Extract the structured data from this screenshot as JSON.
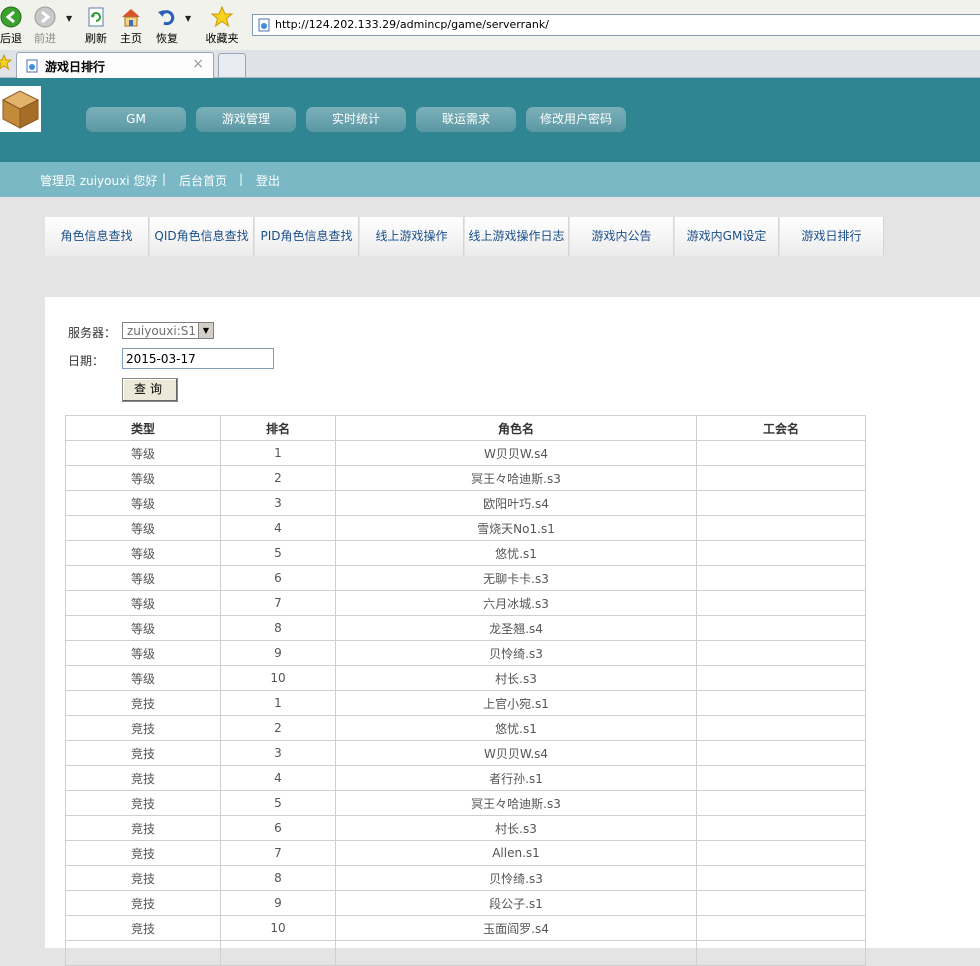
{
  "browser": {
    "buttons": {
      "back": "后退",
      "forward": "前进",
      "refresh": "刷新",
      "home": "主页",
      "restore": "恢复",
      "favorites": "收藏夹"
    },
    "url": "http://124.202.133.29/admincp/game/serverrank/",
    "tab_title": "游戏日排行",
    "tab_close": "×"
  },
  "header": {
    "nav": [
      "GM",
      "游戏管理",
      "实时统计",
      "联运需求",
      "修改用户密码"
    ],
    "greeting": "管理员 zuiyouxi 您好",
    "sep": "|",
    "home_link": "后台首页",
    "logout_link": "登出"
  },
  "subtabs": [
    "角色信息查找",
    "QID角色信息查找",
    "PID角色信息查找",
    "线上游戏操作",
    "线上游戏操作日志",
    "游戏内公告",
    "游戏内GM设定",
    "游戏日排行"
  ],
  "form": {
    "server_label": "服务器：",
    "server_value": "zuiyouxi:S1",
    "date_label": "日期：",
    "date_value": "2015-03-17",
    "query_button": "查询"
  },
  "table": {
    "headers": [
      "类型",
      "排名",
      "角色名",
      "工会名"
    ],
    "rows": [
      [
        "等级",
        "1",
        "W贝贝W.s4",
        ""
      ],
      [
        "等级",
        "2",
        "冥王々哈迪斯.s3",
        ""
      ],
      [
        "等级",
        "3",
        "欧阳叶巧.s4",
        ""
      ],
      [
        "等级",
        "4",
        "雪烧天No1.s1",
        ""
      ],
      [
        "等级",
        "5",
        "悠忧.s1",
        ""
      ],
      [
        "等级",
        "6",
        "无聊卡卡.s3",
        ""
      ],
      [
        "等级",
        "7",
        "六月冰城.s3",
        ""
      ],
      [
        "等级",
        "8",
        "龙圣翘.s4",
        ""
      ],
      [
        "等级",
        "9",
        "贝怜绮.s3",
        ""
      ],
      [
        "等级",
        "10",
        "村长.s3",
        ""
      ],
      [
        "竞技",
        "1",
        "上官小宛.s1",
        ""
      ],
      [
        "竞技",
        "2",
        "悠忧.s1",
        ""
      ],
      [
        "竞技",
        "3",
        "W贝贝W.s4",
        ""
      ],
      [
        "竞技",
        "4",
        "者行孙.s1",
        ""
      ],
      [
        "竞技",
        "5",
        "冥王々哈迪斯.s3",
        ""
      ],
      [
        "竞技",
        "6",
        "村长.s3",
        ""
      ],
      [
        "竞技",
        "7",
        "Allen.s1",
        ""
      ],
      [
        "竞技",
        "8",
        "贝怜绮.s3",
        ""
      ],
      [
        "竞技",
        "9",
        "段公子.s1",
        ""
      ],
      [
        "竞技",
        "10",
        "玉面阎罗.s4",
        ""
      ],
      [
        "",
        "",
        "",
        ""
      ]
    ]
  },
  "colors": {
    "header_bg": "#2f8592",
    "subbar_bg": "#7bb8c6",
    "tab_text": "#1b4f8a"
  },
  "icons": [
    "back-icon",
    "forward-icon",
    "refresh-icon",
    "home-icon",
    "restore-icon",
    "favorites-star-icon",
    "page-icon",
    "logo-box-icon"
  ]
}
